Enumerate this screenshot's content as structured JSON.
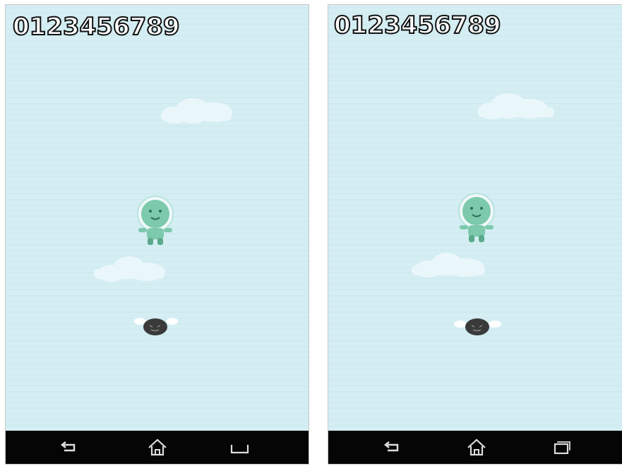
{
  "screens": [
    {
      "id": "left",
      "score": "0123456789",
      "nav": {
        "back": "back-icon",
        "home": "home-icon",
        "recent": "recent-apps-icon"
      }
    },
    {
      "id": "right",
      "score": "0123456789",
      "nav": {
        "back": "back-icon",
        "home": "home-icon",
        "recent": "recent-apps-icon"
      }
    }
  ],
  "colors": {
    "sky": "#d4eef3",
    "alien_body": "#7cc9ac",
    "alien_dark": "#5aa98c",
    "helmet": "#eef8f8",
    "cloud": "#eaf7fa",
    "enemy": "#3a3a3a",
    "navbar": "#050505",
    "nav_icon": "#dcdcdc"
  }
}
